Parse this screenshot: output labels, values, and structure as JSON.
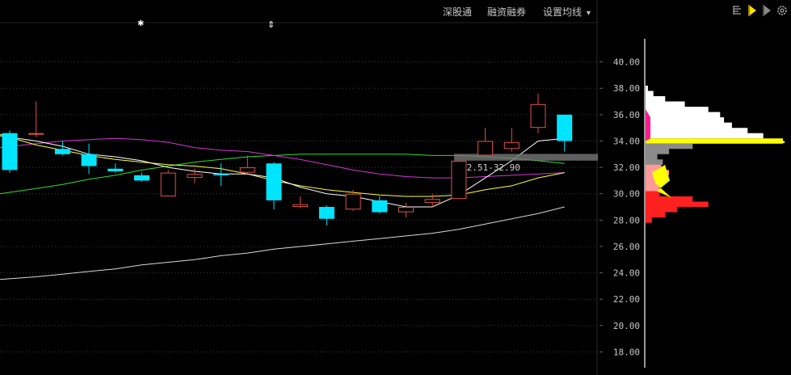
{
  "toolbar": {
    "shengutong": "深股通",
    "rongzi": "融资融券",
    "ma_settings": "设置均线",
    "ma_arrow": "▾"
  },
  "markers": {
    "star": "✱",
    "updown": "⇕"
  },
  "colors": {
    "background": "#000000",
    "grid": "#3a3a3a",
    "up": "#e0524a",
    "down": "#00e5ff",
    "ma5": "#ffffff",
    "ma10": "#ffff3c",
    "ma20": "#d634d6",
    "ma60": "#2ee02e",
    "ma120": "#d8d8d8",
    "axis_text": "#c8c8c8",
    "price_band": "#777777"
  },
  "chart_data": {
    "type": "candlestick",
    "ylim": [
      16.8,
      42.0
    ],
    "y_ticks": [
      "18.00",
      "20.00",
      "22.00",
      "24.00",
      "26.00",
      "28.00",
      "30.00",
      "32.00",
      "34.00",
      "36.00",
      "38.00",
      "40.00"
    ],
    "candles": [
      {
        "o": 34.6,
        "c": 31.8,
        "h": 34.8,
        "l": 31.6
      },
      {
        "o": 34.5,
        "c": 34.6,
        "h": 37.0,
        "l": 34.3
      },
      {
        "o": 33.4,
        "c": 33.0,
        "h": 34.0,
        "l": 32.9
      },
      {
        "o": 33.0,
        "c": 32.1,
        "h": 33.8,
        "l": 31.5
      },
      {
        "o": 31.9,
        "c": 31.7,
        "h": 32.3,
        "l": 31.6
      },
      {
        "o": 31.4,
        "c": 31.0,
        "h": 31.6,
        "l": 30.9
      },
      {
        "o": 29.8,
        "c": 31.6,
        "h": 31.8,
        "l": 29.8
      },
      {
        "o": 31.2,
        "c": 31.5,
        "h": 31.9,
        "l": 30.8
      },
      {
        "o": 31.5,
        "c": 31.4,
        "h": 32.3,
        "l": 30.6
      },
      {
        "o": 31.6,
        "c": 32.0,
        "h": 32.9,
        "l": 31.5
      },
      {
        "o": 32.3,
        "c": 29.5,
        "h": 32.4,
        "l": 28.8
      },
      {
        "o": 29.0,
        "c": 29.2,
        "h": 29.8,
        "l": 28.9
      },
      {
        "o": 29.0,
        "c": 28.1,
        "h": 29.1,
        "l": 27.6
      },
      {
        "o": 28.8,
        "c": 30.0,
        "h": 30.3,
        "l": 28.7
      },
      {
        "o": 29.5,
        "c": 28.6,
        "h": 29.8,
        "l": 28.5
      },
      {
        "o": 28.6,
        "c": 29.0,
        "h": 29.3,
        "l": 28.2
      },
      {
        "o": 29.3,
        "c": 29.6,
        "h": 30.0,
        "l": 29.0
      },
      {
        "o": 29.6,
        "c": 32.5,
        "h": 32.6,
        "l": 29.6
      },
      {
        "o": 32.9,
        "c": 34.0,
        "h": 35.0,
        "l": 32.9
      },
      {
        "o": 33.4,
        "c": 33.9,
        "h": 35.0,
        "l": 33.2
      },
      {
        "o": 35.0,
        "c": 36.8,
        "h": 37.6,
        "l": 34.6
      },
      {
        "o": 36.0,
        "c": 34.0,
        "h": 36.0,
        "l": 33.2
      }
    ],
    "ma5": [
      34.4,
      34.0,
      33.6,
      33.0,
      32.8,
      32.5,
      32.0,
      31.7,
      31.5,
      31.5,
      31.2,
      30.5,
      30.0,
      29.8,
      29.4,
      29.0,
      29.0,
      29.9,
      31.2,
      32.5,
      34.0,
      34.2
    ],
    "ma10": [
      34.5,
      33.7,
      33.3,
      32.9,
      32.6,
      32.4,
      32.2,
      32.1,
      31.9,
      31.5,
      31.0,
      30.6,
      30.3,
      30.1,
      29.9,
      29.8,
      29.8,
      29.9,
      30.3,
      30.6,
      31.2,
      31.6
    ],
    "ma20": [
      33.5,
      33.8,
      34.0,
      34.1,
      34.2,
      34.1,
      33.9,
      33.5,
      33.3,
      33.2,
      32.9,
      32.6,
      32.2,
      31.8,
      31.5,
      31.3,
      31.2,
      31.2,
      31.3,
      31.4,
      31.5,
      31.6
    ],
    "ma60": [
      30.0,
      30.4,
      30.7,
      31.1,
      31.4,
      31.8,
      32.1,
      32.4,
      32.6,
      32.8,
      32.9,
      33.0,
      33.0,
      33.0,
      33.0,
      33.0,
      32.9,
      32.9,
      32.8,
      32.7,
      32.5,
      32.3
    ],
    "ma120": [
      23.5,
      23.7,
      23.9,
      24.1,
      24.3,
      24.6,
      24.8,
      25.0,
      25.3,
      25.5,
      25.8,
      26.0,
      26.2,
      26.4,
      26.6,
      26.8,
      27.0,
      27.3,
      27.7,
      28.1,
      28.5,
      29.0
    ],
    "price_band": {
      "low": 32.51,
      "high": 32.9,
      "label": "32.51-32.90"
    },
    "volume_profile": [
      {
        "price": 38.0,
        "value": 3
      },
      {
        "price": 37.6,
        "value": 10
      },
      {
        "price": 37.2,
        "value": 25
      },
      {
        "price": 36.8,
        "value": 50
      },
      {
        "price": 36.4,
        "value": 80
      },
      {
        "price": 36.0,
        "value": 95
      },
      {
        "price": 35.6,
        "value": 100
      },
      {
        "price": 35.2,
        "value": 110
      },
      {
        "price": 34.8,
        "value": 130
      },
      {
        "price": 34.4,
        "value": 150
      },
      {
        "price": 34.0,
        "value": 175
      },
      {
        "price": 33.6,
        "value": 60
      },
      {
        "price": 33.2,
        "value": 30
      },
      {
        "price": 32.8,
        "value": 15
      },
      {
        "price": 32.4,
        "value": 22
      },
      {
        "price": 32.0,
        "value": 20
      },
      {
        "price": 31.6,
        "value": 30
      },
      {
        "price": 31.2,
        "value": 26
      },
      {
        "price": 30.8,
        "value": 20
      },
      {
        "price": 30.4,
        "value": 18
      },
      {
        "price": 30.0,
        "value": 18
      },
      {
        "price": 29.6,
        "value": 60
      },
      {
        "price": 29.2,
        "value": 80
      },
      {
        "price": 28.8,
        "value": 40
      },
      {
        "price": 28.4,
        "value": 25
      },
      {
        "price": 28.0,
        "value": 8
      }
    ]
  }
}
